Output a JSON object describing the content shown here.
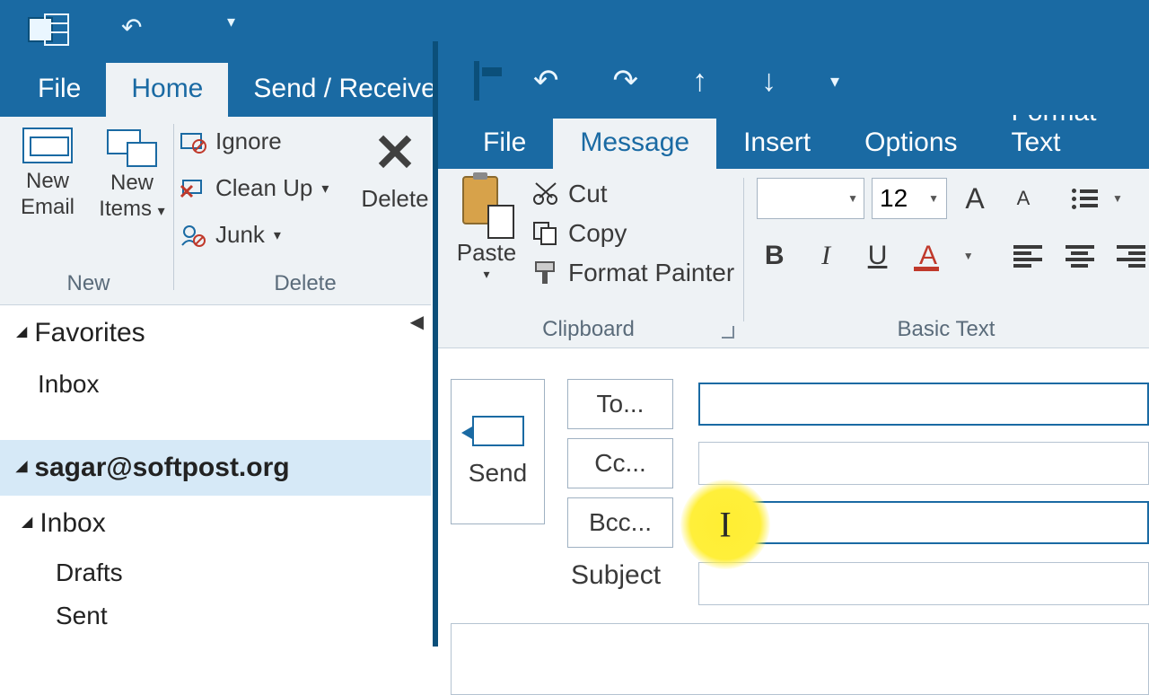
{
  "main": {
    "tabs": {
      "file": "File",
      "home": "Home",
      "sendreceive": "Send / Receive"
    },
    "groups": {
      "new": "New",
      "delete": "Delete"
    },
    "buttons": {
      "new_email": "New\nEmail",
      "new_items": "New\nItems",
      "ignore": "Ignore",
      "cleanup": "Clean Up",
      "junk": "Junk",
      "delete": "Delete"
    },
    "nav": {
      "favorites": "Favorites",
      "inbox": "Inbox",
      "account": "sagar@softpost.org",
      "drafts": "Drafts",
      "sent": "Sent"
    }
  },
  "compose": {
    "tabs": {
      "file": "File",
      "message": "Message",
      "insert": "Insert",
      "options": "Options",
      "formattext": "Format Text"
    },
    "clipboard": {
      "paste": "Paste",
      "cut": "Cut",
      "copy": "Copy",
      "format_painter": "Format Painter",
      "group": "Clipboard"
    },
    "basictext": {
      "group": "Basic Text",
      "font_size": "12",
      "bold": "B",
      "italic": "I",
      "underline": "U",
      "fontcolor": "A"
    },
    "fields": {
      "send": "Send",
      "to": "To...",
      "cc": "Cc...",
      "bcc": "Bcc...",
      "subject": "Subject"
    },
    "values": {
      "to": "",
      "cc": "",
      "bcc": "",
      "subject": ""
    }
  }
}
